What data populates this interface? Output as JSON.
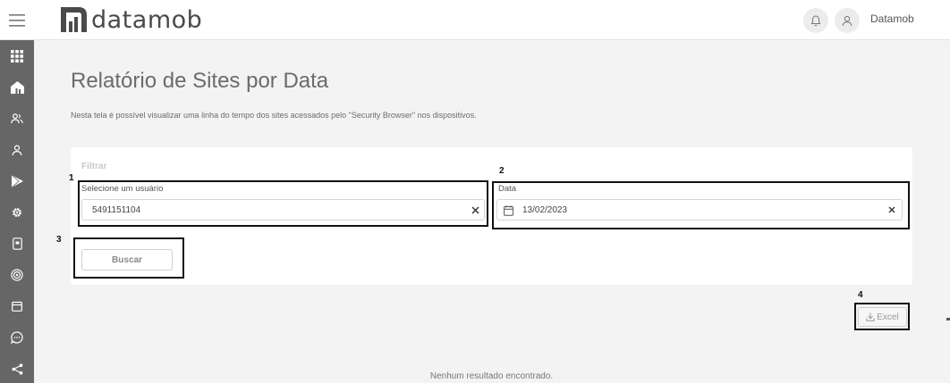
{
  "header": {
    "logo_text": "datamob",
    "user_name": "Datamob"
  },
  "sidebar": {
    "items": [
      {
        "icon": "apps-grid-icon"
      },
      {
        "icon": "home-icon"
      },
      {
        "icon": "users-icon"
      },
      {
        "icon": "user-icon"
      },
      {
        "icon": "play-store-icon"
      },
      {
        "icon": "gear-icon"
      },
      {
        "icon": "device-icon"
      },
      {
        "icon": "location-target-icon"
      },
      {
        "icon": "calendar-icon"
      },
      {
        "icon": "chat-icon"
      },
      {
        "icon": "share-icon"
      }
    ]
  },
  "page": {
    "title": "Relatório de Sites por Data",
    "description": "Nesta tela é possível visualizar uma linha do tempo dos sites acessados pelo \"Security Browser\" nos dispositivos."
  },
  "filter": {
    "title": "Filtrar",
    "user_label": "Selecione um usuário",
    "user_value": "5491151104",
    "date_label": "Data",
    "date_value": "13/02/2023",
    "search_label": "Buscar"
  },
  "annotations": {
    "n1": "1",
    "n2": "2",
    "n3": "3",
    "n4": "4"
  },
  "export": {
    "excel_label": "Excel"
  },
  "results": {
    "empty_text": "Nenhum resultado encontrado."
  }
}
